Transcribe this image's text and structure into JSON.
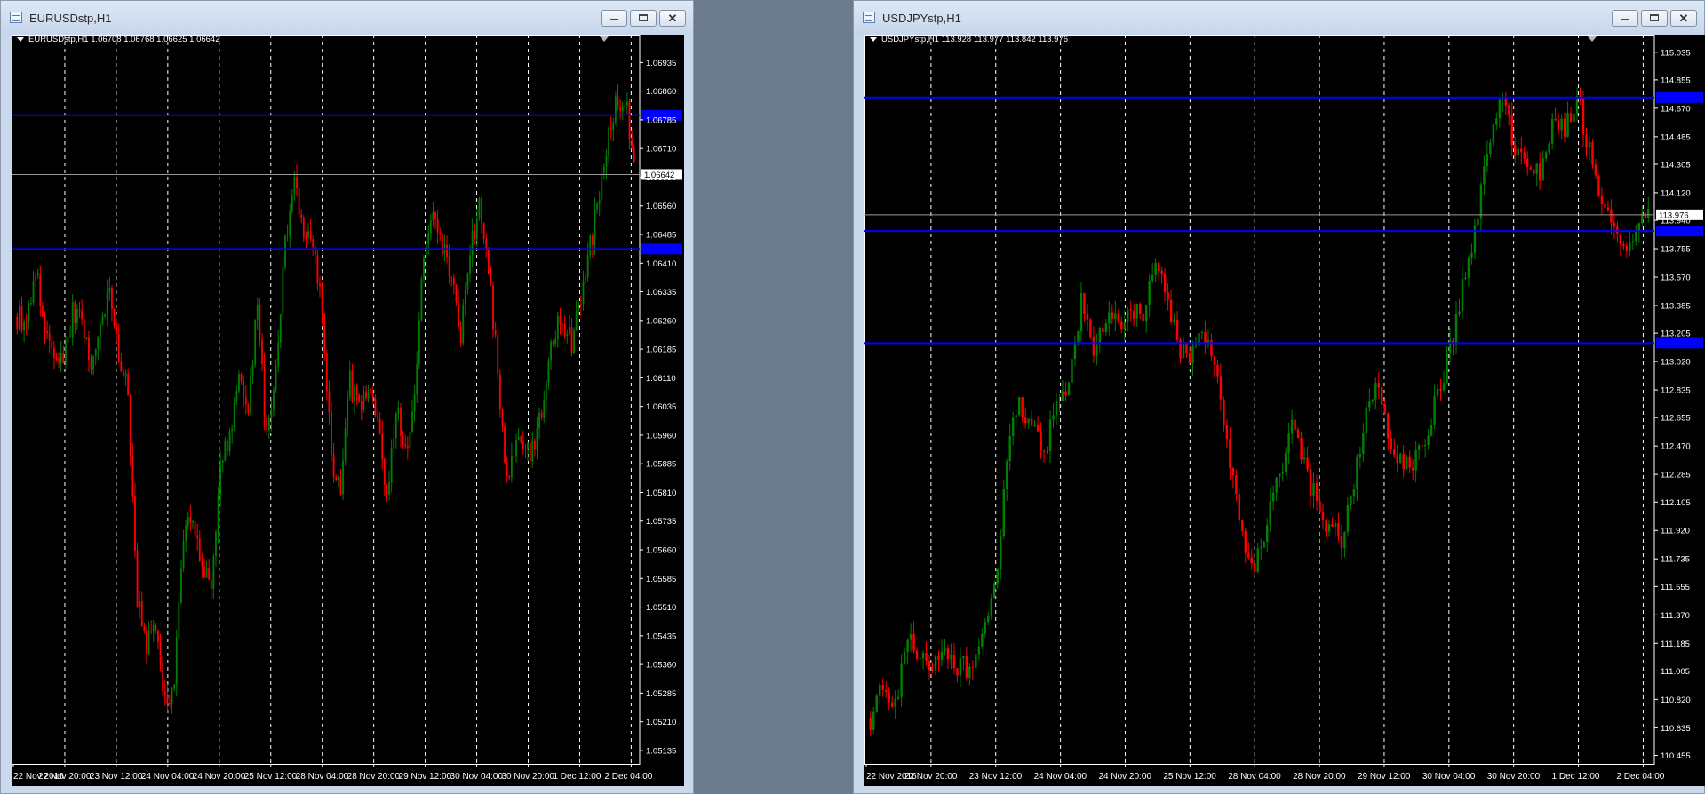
{
  "theme": {
    "chart_bg": "#000000",
    "axis_text": "#ffffff",
    "grid": "#ffffff",
    "bull": "#008000",
    "bear": "#ff0000",
    "hline": "#0000ff",
    "bid_line": "#9a9a9a"
  },
  "windows": [
    {
      "title": "EURUSDstp,H1",
      "info": "EURUSDstp,H1  1.06708 1.06768 1.06625 1.06642",
      "buttons": {
        "minimize": "minimize",
        "maximize": "restore",
        "close": "close"
      },
      "chart_data": {
        "type": "candlestick",
        "symbol": "EURUSDstp",
        "timeframe": "H1",
        "ohlc_current": {
          "open": 1.06708,
          "high": 1.06768,
          "low": 1.06625,
          "close": 1.06642
        },
        "ylim": [
          1.051,
          1.0698
        ],
        "price_ticks": [
          "1.06935",
          "1.06860",
          "1.06785",
          "1.06710",
          "1.06635",
          "1.06560",
          "1.06485",
          "1.06410",
          "1.06335",
          "1.06260",
          "1.06185",
          "1.06110",
          "1.06035",
          "1.05960",
          "1.05885",
          "1.05810",
          "1.05735",
          "1.05660",
          "1.05585",
          "1.05510",
          "1.05435",
          "1.05360",
          "1.05285",
          "1.05210",
          "1.05135"
        ],
        "time_labels": [
          "22 Nov 2016",
          "22 Nov 20:00",
          "23 Nov 12:00",
          "24 Nov 04:00",
          "24 Nov 20:00",
          "25 Nov 12:00",
          "28 Nov 04:00",
          "28 Nov 20:00",
          "29 Nov 12:00",
          "30 Nov 04:00",
          "30 Nov 20:00",
          "1 Dec 12:00",
          "2 Dec 04:00"
        ],
        "bid_label": "1.06642",
        "bid": 1.06642,
        "horizontal_lines": [
          1.06797,
          1.06447
        ],
        "path": [
          1.0627,
          1.0626,
          1.064,
          1.0622,
          1.0616,
          1.0616,
          1.0628,
          1.0627,
          1.0613,
          1.0625,
          1.0636,
          1.0615,
          1.0607,
          1.0552,
          1.0541,
          1.0546,
          1.0525,
          1.0531,
          1.0571,
          1.0575,
          1.056,
          1.0557,
          1.0587,
          1.0596,
          1.0611,
          1.0604,
          1.063,
          1.0594,
          1.0613,
          1.0646,
          1.0665,
          1.0649,
          1.0647,
          1.0628,
          1.059,
          1.0581,
          1.061,
          1.0602,
          1.0609,
          1.0598,
          1.058,
          1.0604,
          1.0591,
          1.0607,
          1.0644,
          1.0652,
          1.0646,
          1.0637,
          1.0621,
          1.0645,
          1.0655,
          1.0639,
          1.0613,
          1.0585,
          1.0595,
          1.059,
          1.0595,
          1.0606,
          1.0623,
          1.0625,
          1.062,
          1.0632,
          1.0646,
          1.0658,
          1.0675,
          1.0684,
          1.068,
          1.0664
        ]
      }
    },
    {
      "title": "USDJPYstp,H1",
      "info": "USDJPYstp,H1  113.928 113.977 113.842 113.976",
      "buttons": {
        "minimize": "minimize",
        "maximize": "restore",
        "close": "close"
      },
      "chart_data": {
        "type": "candlestick",
        "symbol": "USDJPYstp",
        "timeframe": "H1",
        "ohlc_current": {
          "open": 113.928,
          "high": 113.977,
          "low": 113.842,
          "close": 113.976
        },
        "ylim": [
          110.4,
          115.08
        ],
        "price_ticks": [
          "115.035",
          "114.855",
          "114.670",
          "114.485",
          "114.305",
          "114.120",
          "113.940",
          "113.755",
          "113.570",
          "113.385",
          "113.205",
          "113.020",
          "112.835",
          "112.655",
          "112.470",
          "112.285",
          "112.105",
          "111.920",
          "111.735",
          "111.555",
          "111.370",
          "111.185",
          "111.005",
          "110.820",
          "110.635",
          "110.455"
        ],
        "time_labels": [
          "22 Nov 2016",
          "22 Nov 20:00",
          "23 Nov 12:00",
          "24 Nov 04:00",
          "24 Nov 20:00",
          "25 Nov 12:00",
          "28 Nov 04:00",
          "28 Nov 20:00",
          "29 Nov 12:00",
          "30 Nov 04:00",
          "30 Nov 20:00",
          "1 Dec 12:00",
          "2 Dec 04:00"
        ],
        "bid_label": "113.976",
        "bid": 113.976,
        "horizontal_lines": [
          114.74,
          113.87,
          113.14
        ],
        "path": [
          110.7,
          110.95,
          110.8,
          111.25,
          111.1,
          111.05,
          111.2,
          111.05,
          111.0,
          111.2,
          111.5,
          112.4,
          112.8,
          112.55,
          112.45,
          112.7,
          112.9,
          113.4,
          113.1,
          113.3,
          113.25,
          113.4,
          113.3,
          113.7,
          113.4,
          113.1,
          113.05,
          113.2,
          112.9,
          112.3,
          111.9,
          111.7,
          112.0,
          112.3,
          112.6,
          112.35,
          112.1,
          111.95,
          111.85,
          112.2,
          112.7,
          112.9,
          112.5,
          112.3,
          112.4,
          112.6,
          112.85,
          113.2,
          113.6,
          114.0,
          114.5,
          114.7,
          114.4,
          114.3,
          114.25,
          114.6,
          114.5,
          114.75,
          114.4,
          114.0,
          113.85,
          113.7,
          113.9,
          113.95
        ]
      }
    }
  ]
}
